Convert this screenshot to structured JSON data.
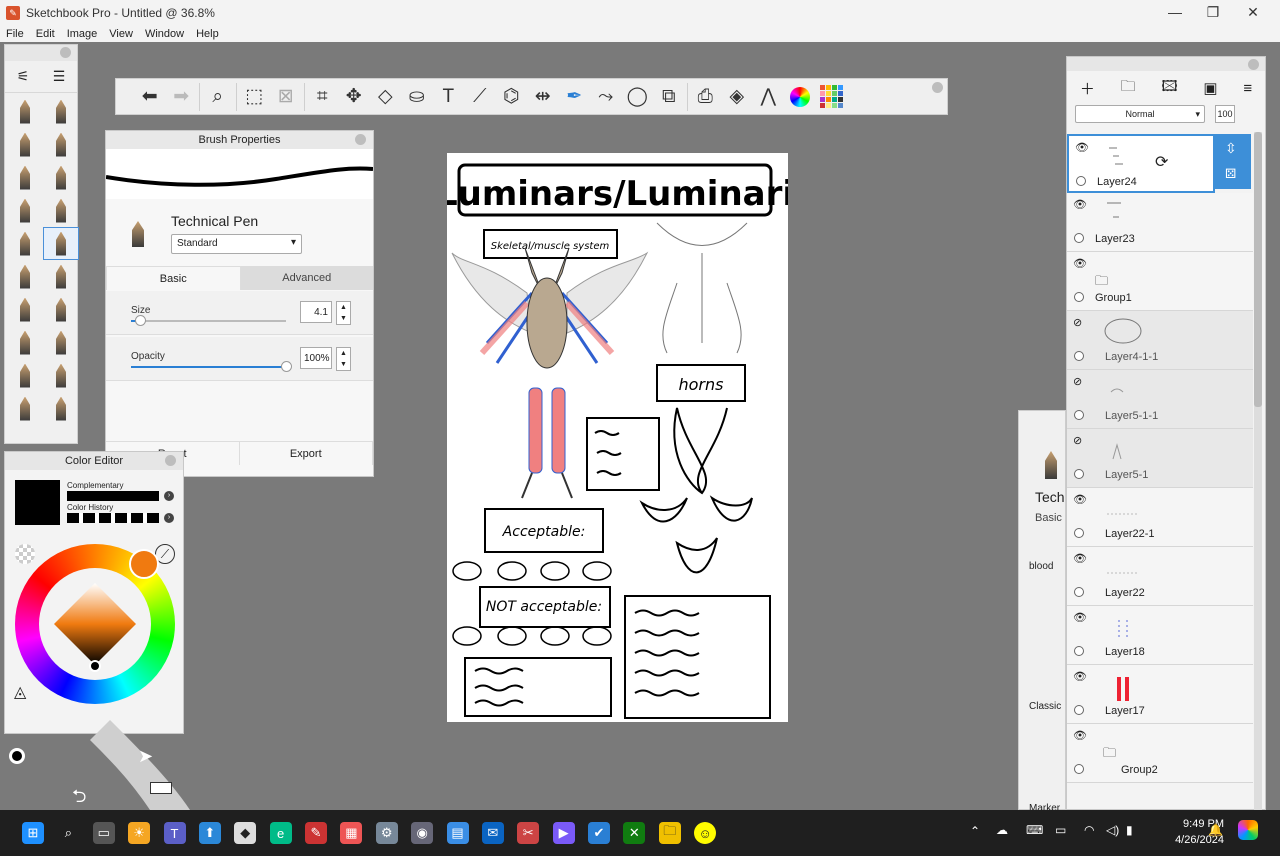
{
  "window": {
    "title": "Sketchbook Pro - Untitled @ 36.8%",
    "minimize": "—",
    "maximize": "❐",
    "close": "✕"
  },
  "menu": [
    "File",
    "Edit",
    "Image",
    "View",
    "Window",
    "Help"
  ],
  "toolbar": {
    "tools": [
      "undo-icon",
      "redo-icon",
      "zoom-icon",
      "select-icon",
      "select-clear-icon",
      "crop-icon",
      "transform-icon",
      "distort-icon",
      "fill-icon",
      "text-icon",
      "ruler-icon",
      "perspective-icon",
      "symmetry-icon",
      "pen-icon",
      "stroke-icon",
      "ellipse-icon",
      "shapes-icon",
      "screenshot-icon",
      "layers-icon",
      "brush-library-icon",
      "color-wheel-icon",
      "swatches-icon"
    ]
  },
  "brush_properties": {
    "title": "Brush Properties",
    "brush_name": "Technical Pen",
    "preset": "Standard",
    "tabs": [
      "Basic",
      "Advanced"
    ],
    "size_label": "Size",
    "size_value": "4.1",
    "size_fraction": 0.06,
    "opacity_label": "Opacity",
    "opacity_value": "100%",
    "opacity_fraction": 1.0,
    "footer": [
      "Reset",
      "Export"
    ]
  },
  "color_editor": {
    "title": "Color Editor",
    "complementary_label": "Complementary",
    "history_label": "Color History",
    "current_color": "#000000",
    "hue_color": "#f07a10"
  },
  "canvas": {
    "heading": "Luminars/Luminari",
    "box1": "Skeletal/muscle system",
    "box2": "horns",
    "box3": "Acceptable:",
    "box4": "NOT acceptable:"
  },
  "layers": {
    "blend_mode": "Normal",
    "opacity": "100",
    "items": [
      {
        "name": "Layer24",
        "visible": true,
        "selected": true
      },
      {
        "name": "Layer23",
        "visible": true
      },
      {
        "name": "Group1",
        "visible": true,
        "group": true
      },
      {
        "name": "Layer4-1-1",
        "visible": false
      },
      {
        "name": "Layer5-1-1",
        "visible": false
      },
      {
        "name": "Layer5-1",
        "visible": false
      },
      {
        "name": "Layer22-1",
        "visible": true
      },
      {
        "name": "Layer22",
        "visible": true
      },
      {
        "name": "Layer18",
        "visible": true
      },
      {
        "name": "Layer17",
        "visible": true
      },
      {
        "name": "Group2",
        "visible": true,
        "group": true
      }
    ]
  },
  "right_panel": {
    "brush": "Tech",
    "tab": "Basic",
    "set1": "blood",
    "set2": "Classic",
    "set3": "Marker"
  },
  "taskbar": {
    "time": "9:49 PM",
    "date": "4/26/2024"
  }
}
